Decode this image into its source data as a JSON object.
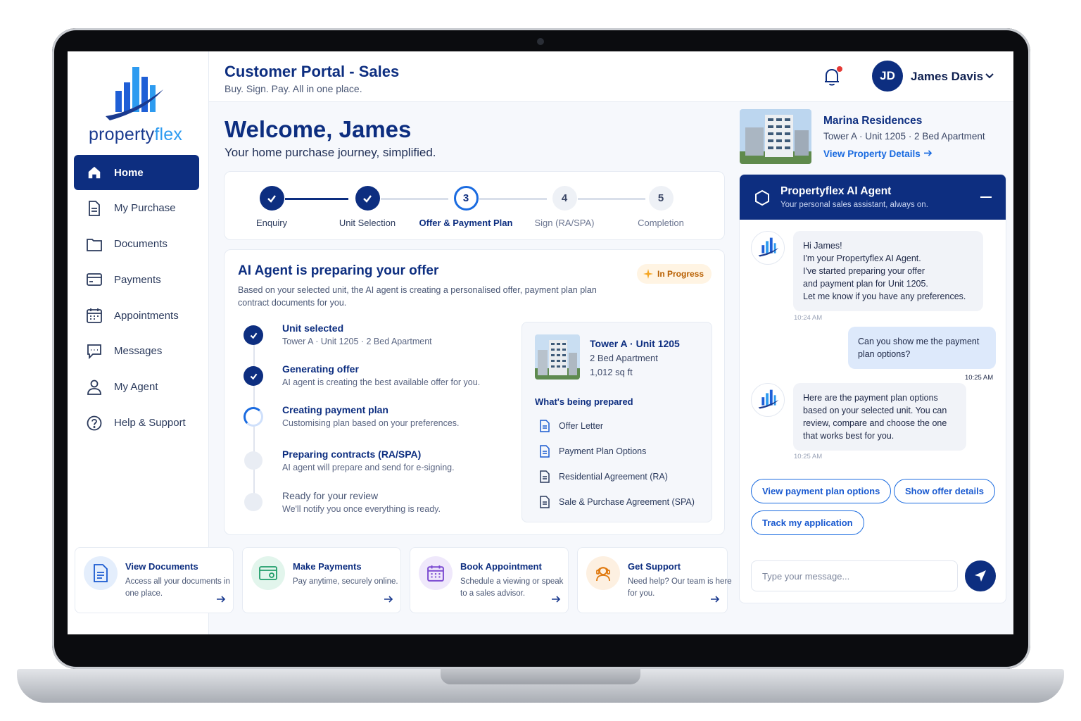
{
  "brand": {
    "logo_part1": "property",
    "logo_part2": "flex"
  },
  "sidebar": {
    "items": [
      {
        "label": "Home",
        "icon": "home-icon"
      },
      {
        "label": "My Purchase",
        "icon": "file-icon"
      },
      {
        "label": "Documents",
        "icon": "folder-icon"
      },
      {
        "label": "Payments",
        "icon": "card-icon"
      },
      {
        "label": "Appointments",
        "icon": "calendar-icon"
      },
      {
        "label": "Messages",
        "icon": "chat-icon"
      },
      {
        "label": "My Agent",
        "icon": "user-icon"
      },
      {
        "label": "Help & Support",
        "icon": "help-icon"
      }
    ]
  },
  "header": {
    "title": "Customer Portal - Sales",
    "subtitle": "Buy. Sign. Pay. All in one place.",
    "avatar_initials": "JD",
    "user_name": "James Davis"
  },
  "welcome": {
    "title": "Welcome, James",
    "subtitle": "Your home purchase journey, simplified."
  },
  "stepper": {
    "steps": [
      {
        "num": "1",
        "label": "Enquiry",
        "state": "done"
      },
      {
        "num": "2",
        "label": "Unit Selection",
        "state": "done"
      },
      {
        "num": "3",
        "label": "Offer & Payment Plan",
        "state": "current"
      },
      {
        "num": "4",
        "label": "Sign (RA/SPA)",
        "state": "todo"
      },
      {
        "num": "5",
        "label": "Completion",
        "state": "todo"
      }
    ]
  },
  "offer": {
    "title": "AI Agent is preparing your offer",
    "badge": "In Progress",
    "description": "Based on your selected unit, the AI agent is creating a personalised offer, payment plan plan contract documents for you.",
    "timeline": [
      {
        "title": "Unit selected",
        "desc": "Tower A · Unit 1205 · 2 Bed Apartment",
        "state": "done"
      },
      {
        "title": "Generating offer",
        "desc": "AI agent is creating the best available offer for you.",
        "state": "done"
      },
      {
        "title": "Creating payment plan",
        "desc": "Customising plan based on your preferences.",
        "state": "progress"
      },
      {
        "title": "Preparing contracts (RA/SPA)",
        "desc": "AI agent will prepare and send for e-signing.",
        "state": "todo"
      },
      {
        "title": "Ready for your review",
        "desc": "We'll notify you once everything is ready.",
        "state": "todo"
      }
    ],
    "unit": {
      "name": "Tower A · Unit 1205",
      "type": "2 Bed Apartment",
      "size": "1,012 sq ft"
    },
    "prepared_heading": "What's being prepared",
    "prepared_docs": [
      "Offer Letter",
      "Payment Plan Options",
      "Residential Agreement (RA)",
      "Sale & Purchase Agreement (SPA)"
    ]
  },
  "quick_actions": [
    {
      "title": "View Documents",
      "desc": "Access all your documents in one place.",
      "icon": "document-icon",
      "color": "#e4eefc"
    },
    {
      "title": "Make Payments",
      "desc": "Pay anytime, securely online.",
      "icon": "payment-card-icon",
      "color": "#e2f5ec"
    },
    {
      "title": "Book Appointment",
      "desc": "Schedule a viewing or speak to a sales advisor.",
      "icon": "calendar-icon",
      "color": "#efe8fb"
    },
    {
      "title": "Get Support",
      "desc": "Need help? Our team is here for you.",
      "icon": "support-agent-icon",
      "color": "#fdf0e1"
    }
  ],
  "property": {
    "name": "Marina Residences",
    "subtitle": "Tower A · Unit 1205 · 2 Bed Apartment",
    "link": "View Property Details"
  },
  "chat": {
    "title": "Propertyflex AI Agent",
    "subtitle": "Your personal sales assistant, always on.",
    "messages": [
      {
        "from": "bot",
        "lines": [
          "Hi James!",
          "I'm your Propertyflex AI Agent.",
          "I've started preparing your offer",
          "and payment plan for Unit 1205.",
          "Let me know if you have any preferences."
        ],
        "time": "10:24 AM"
      },
      {
        "from": "user",
        "lines": [
          "Can you show me the payment",
          "plan options?"
        ],
        "time": "10:25 AM"
      },
      {
        "from": "bot",
        "lines": [
          "Here are the payment plan options",
          "based on your selected unit. You can",
          "review, compare and choose the one",
          "that works best for you."
        ],
        "time": "10:25 AM"
      }
    ],
    "chips": [
      "View payment plan options",
      "Show offer details",
      "Track my application"
    ],
    "input_placeholder": "Type your message..."
  }
}
